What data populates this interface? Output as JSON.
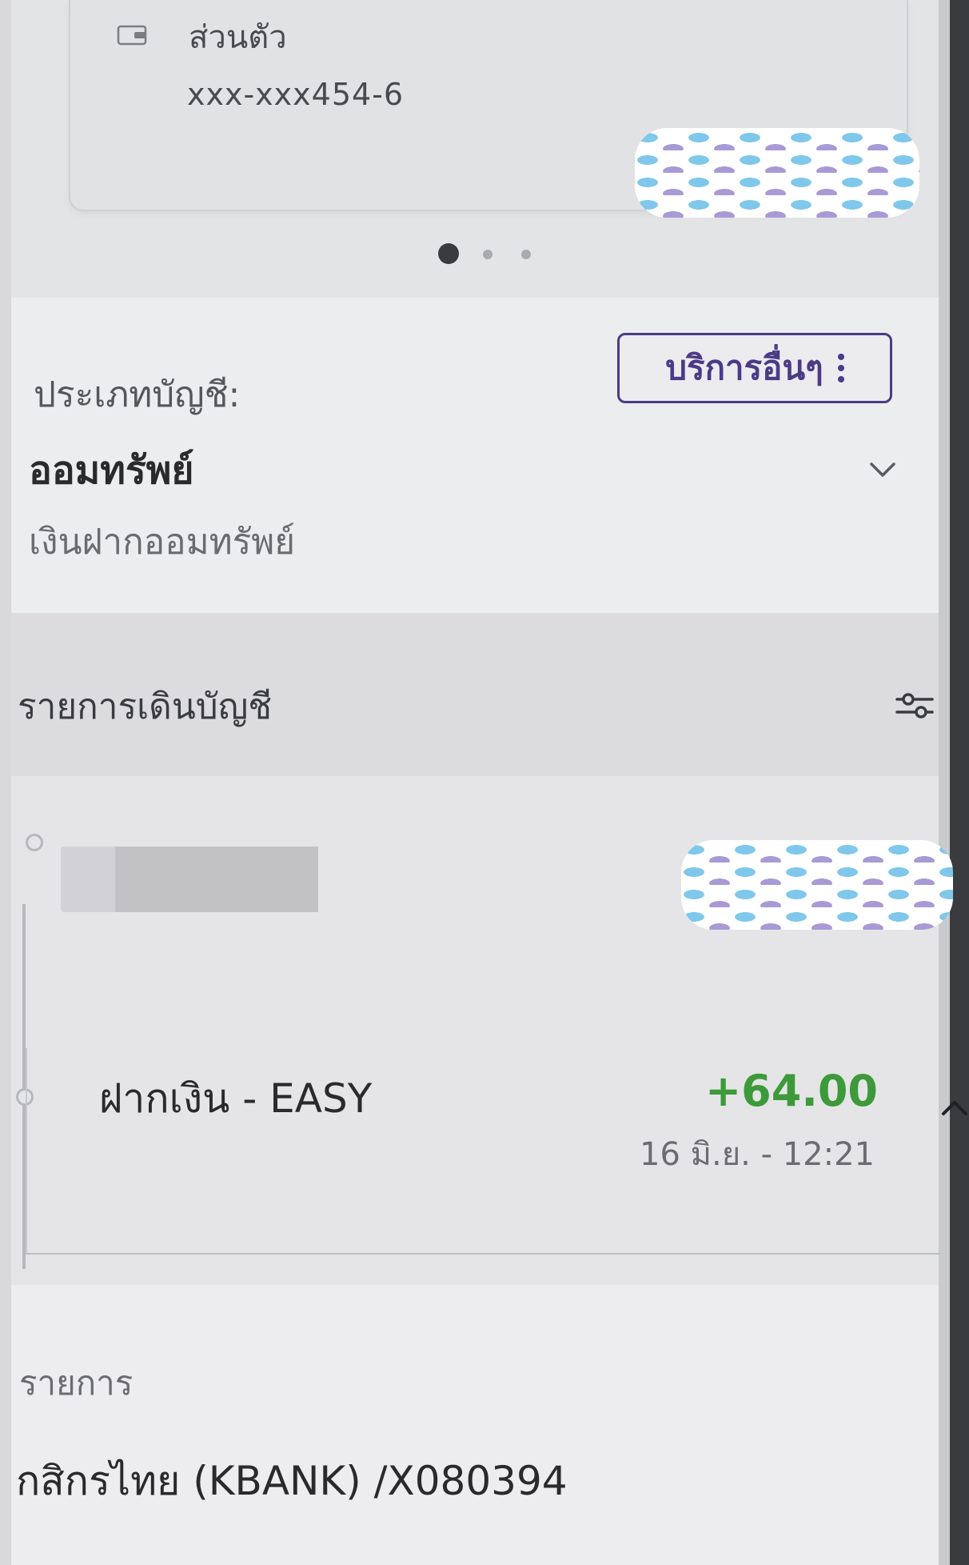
{
  "account_card": {
    "type_label": "ส่วนตัว",
    "account_number": "xxx-xxx454-6",
    "carousel": {
      "pages": 3,
      "active_index": 0
    }
  },
  "account_type": {
    "label": "ประเภทบัญชี:",
    "value": "ออมทรัพย์",
    "description": "เงินฝากออมทรัพย์",
    "other_services_button": "บริการอื่นๆ"
  },
  "statement": {
    "title": "รายการเดินบัญชี"
  },
  "transactions": [
    {
      "name": "ฝากเงิน - EASY",
      "amount": "+64.00",
      "datetime": "16 มิ.ย. - 12:21",
      "expanded": true
    }
  ],
  "detail": {
    "label": "รายการ",
    "value": "กสิกรไทย (KBANK) /X080394"
  },
  "colors": {
    "accent_purple": "#4b3b86",
    "amount_green": "#3d9a3a"
  },
  "icons": [
    "wallet-icon",
    "kebab-menu-icon",
    "chevron-down-icon",
    "filter-sliders-icon",
    "chevron-up-icon"
  ]
}
